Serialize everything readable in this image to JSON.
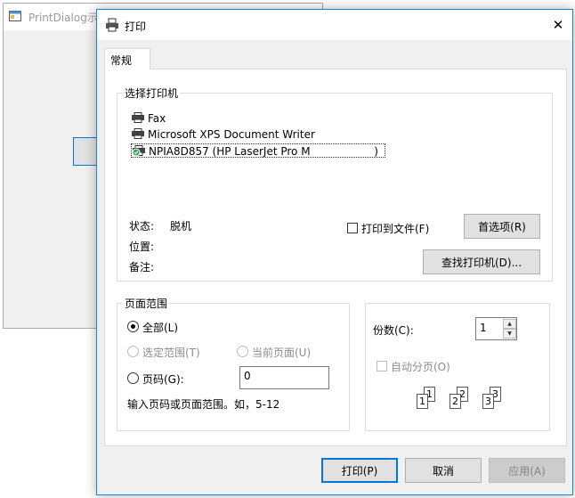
{
  "background_window": {
    "title": "PrintDialog示"
  },
  "dialog": {
    "title": "打印",
    "close_glyph": "✕",
    "tab_label": "常规",
    "printer_section": {
      "title": "选择打印机",
      "printers": [
        {
          "name": "Fax",
          "icon": "fax-printer-icon"
        },
        {
          "name": "Microsoft XPS Document Writer",
          "icon": "printer-icon"
        },
        {
          "name": "NPIA8D857 (HP LaserJet Pro M",
          "suffix": "  )",
          "icon": "default-printer-icon",
          "selected": true
        }
      ],
      "status_label": "状态:",
      "status_value": "脱机",
      "location_label": "位置:",
      "location_value": "",
      "comment_label": "备注:",
      "comment_value": "",
      "print_to_file_label": "打印到文件(F)",
      "preferences_button": "首选项(R)",
      "find_printer_button": "查找打印机(D)..."
    },
    "page_range": {
      "title": "页面范围",
      "all_label": "全部(L)",
      "selection_label": "选定范围(T)",
      "current_page_label": "当前页面(U)",
      "pages_label": "页码(G):",
      "pages_value": "0",
      "hint": "输入页码或页面范围。如，5-12"
    },
    "copies": {
      "label": "份数(C):",
      "value": "1",
      "collate_label": "自动分页(O)",
      "collate_pages": [
        "1",
        "1",
        "2",
        "2",
        "3",
        "3"
      ]
    },
    "buttons": {
      "print": "打印(P)",
      "cancel": "取消",
      "apply": "应用(A)"
    }
  }
}
